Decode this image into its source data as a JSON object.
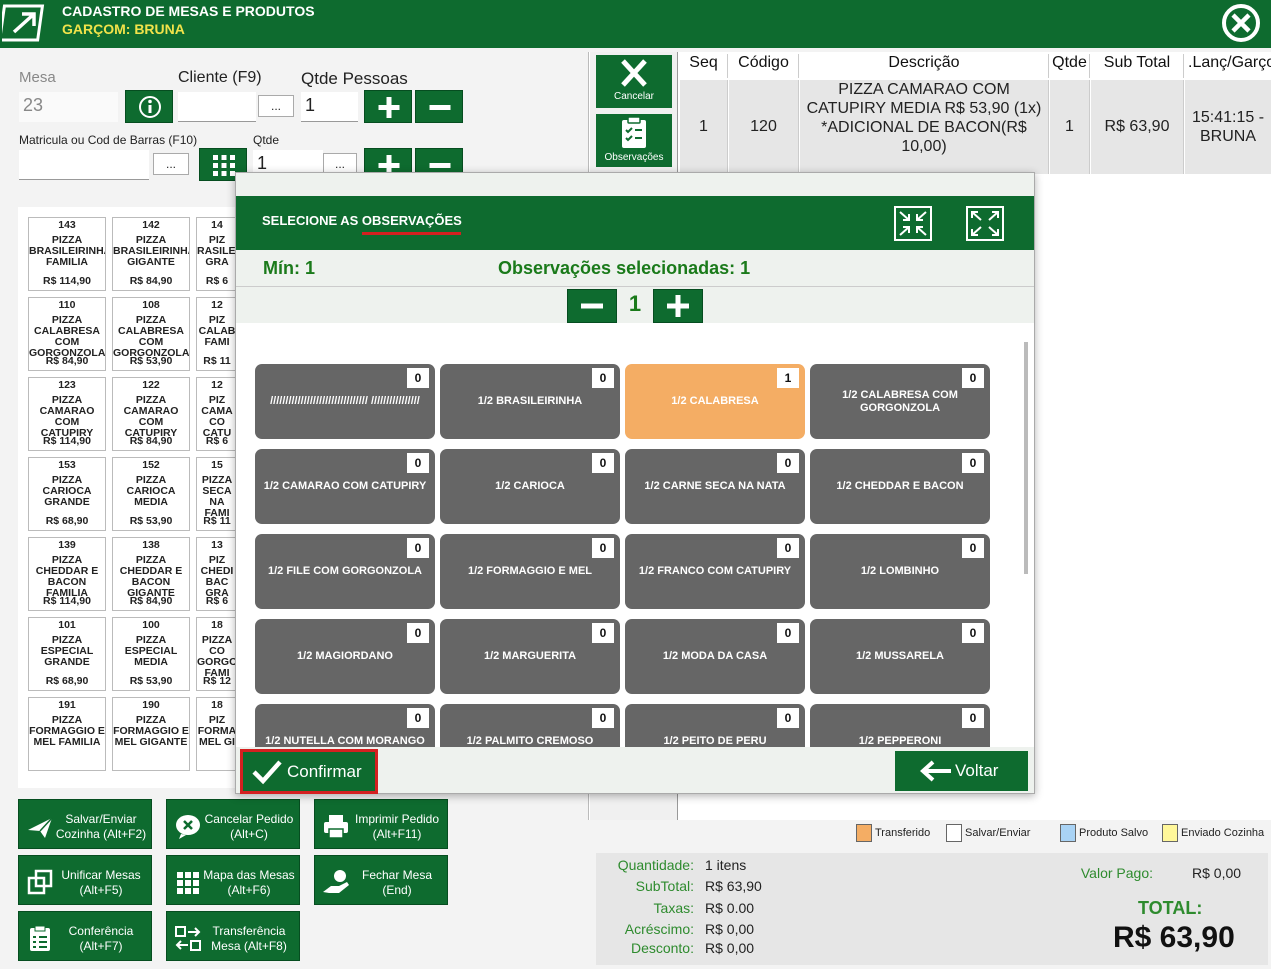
{
  "header": {
    "title": "CADASTRO DE MESAS E PRODUTOS",
    "subtitle": "GARÇOM: BRUNA"
  },
  "form": {
    "mesa_label": "Mesa",
    "mesa_value": "23",
    "cliente_label": "Cliente (F9)",
    "cliente_value": "",
    "qtde_pessoas_label": "Qtde Pessoas",
    "qtde_pessoas_value": "1",
    "matricula_label": "Matricula ou Cod de Barras (F10)",
    "matricula_value": "",
    "qtde_label": "Qtde",
    "qtde_value": "1",
    "dots": "..."
  },
  "products": [
    {
      "code": "143",
      "name": "PIZZA BRASILEIRINHA FAMILIA",
      "price": "R$ 114,90"
    },
    {
      "code": "142",
      "name": "PIZZA BRASILEIRINHA GIGANTE",
      "price": "R$ 84,90"
    },
    {
      "code": "14",
      "name": "PIZ RASILEI GRA",
      "price": "R$ 6"
    },
    {
      "code": "110",
      "name": "PIZZA CALABRESA COM GORGONZOLA",
      "price": "R$ 84,90"
    },
    {
      "code": "108",
      "name": "PIZZA CALABRESA COM GORGONZOLA",
      "price": "R$ 53,90"
    },
    {
      "code": "12",
      "name": "PIZ CALAB FAMI",
      "price": "R$ 11"
    },
    {
      "code": "123",
      "name": "PIZZA CAMARAO COM CATUPIRY",
      "price": "R$ 114,90"
    },
    {
      "code": "122",
      "name": "PIZZA CAMARAO COM CATUPIRY",
      "price": "R$ 84,90"
    },
    {
      "code": "12",
      "name": "PIZ CAMA CO CATU",
      "price": "R$ 6"
    },
    {
      "code": "153",
      "name": "PIZZA CARIOCA GRANDE",
      "price": "R$ 68,90"
    },
    {
      "code": "152",
      "name": "PIZZA CARIOCA MEDIA",
      "price": "R$ 53,90"
    },
    {
      "code": "15",
      "name": "PIZZA SECA NA FAMI",
      "price": "R$ 11"
    },
    {
      "code": "139",
      "name": "PIZZA CHEDDAR E BACON FAMILIA",
      "price": "R$ 114,90"
    },
    {
      "code": "138",
      "name": "PIZZA CHEDDAR E BACON GIGANTE",
      "price": "R$ 84,90"
    },
    {
      "code": "13",
      "name": "PIZ CHEDI BAC GRA",
      "price": "R$ 6"
    },
    {
      "code": "101",
      "name": "PIZZA ESPECIAL GRANDE",
      "price": "R$ 68,90"
    },
    {
      "code": "100",
      "name": "PIZZA ESPECIAL MEDIA",
      "price": "R$ 53,90"
    },
    {
      "code": "18",
      "name": "PIZZA CO GORGO FAMI",
      "price": "R$ 12"
    },
    {
      "code": "191",
      "name": "PIZZA FORMAGGIO E MEL FAMILIA",
      "price": ""
    },
    {
      "code": "190",
      "name": "PIZZA FORMAGGIO E MEL GIGANTE",
      "price": ""
    },
    {
      "code": "18",
      "name": "PIZ FORMA MEL GI",
      "price": ""
    }
  ],
  "actions": [
    {
      "label": "Salvar/Enviar Cozinha (Alt+F2)",
      "icon": "send-icon"
    },
    {
      "label": "Cancelar Pedido (Alt+C)",
      "icon": "cancel-chat-icon"
    },
    {
      "label": "Imprimir Pedido (Alt+F11)",
      "icon": "printer-icon"
    },
    {
      "label": "Unificar Mesas (Alt+F5)",
      "icon": "unify-icon"
    },
    {
      "label": "Mapa das Mesas (Alt+F6)",
      "icon": "grid-icon"
    },
    {
      "label": "Fechar Mesa (End)",
      "icon": "money-hand-icon"
    },
    {
      "label": "Conferência (Alt+F7)",
      "icon": "checklist-icon"
    },
    {
      "label": "Transferência Mesa (Alt+F8)",
      "icon": "transfer-icon"
    }
  ],
  "side_buttons": {
    "cancelar": "Cancelar",
    "observacoes": "Observações"
  },
  "table": {
    "headers": [
      "Seq",
      "Código",
      "Descrição",
      "Qtde",
      "Sub Total",
      ".Lanç/Garço"
    ],
    "row": {
      "seq": "1",
      "codigo": "120",
      "descricao": "PIZZA CAMARAO COM CATUPIRY MEDIA R$ 53,90 (1x) *ADICIONAL DE BACON(R$ 10,00)",
      "qtde": "1",
      "subtotal": "R$ 63,90",
      "lanc": "15:41:15 - BRUNA"
    }
  },
  "legend": [
    {
      "label": "Transferido",
      "color": "#f4ad64"
    },
    {
      "label": "Salvar/Enviar",
      "color": "#ffffff"
    },
    {
      "label": "Produto Salvo",
      "color": "#a9d3f5"
    },
    {
      "label": "Enviado Cozinha",
      "color": "#fff79a"
    }
  ],
  "totals": {
    "quantidade_label": "Quantidade:",
    "quantidade": "1 itens",
    "subtotal_label": "SubTotal:",
    "subtotal": "R$ 63,90",
    "taxas_label": "Taxas:",
    "taxas": "R$ 0.00",
    "acrescimo_label": "Acréscimo:",
    "acrescimo": "R$ 0,00",
    "desconto_label": "Desconto:",
    "desconto": "R$ 0,00",
    "valor_pago_label": "Valor Pago:",
    "valor_pago": "R$ 0,00",
    "total_label": "TOTAL:",
    "total": "R$ 63,90"
  },
  "modal": {
    "title": "SELECIONE AS OBSERVAÇÕES",
    "min_label": "Mín: 1",
    "selected_label": "Observações selecionadas: 1",
    "stepper_value": "1",
    "options": [
      {
        "label": "//////////////////////////////// ////////////////",
        "count": "0",
        "selected": false
      },
      {
        "label": "1/2 BRASILEIRINHA",
        "count": "0",
        "selected": false
      },
      {
        "label": "1/2 CALABRESA",
        "count": "1",
        "selected": true
      },
      {
        "label": "1/2 CALABRESA COM GORGONZOLA",
        "count": "0",
        "selected": false
      },
      {
        "label": "1/2 CAMARAO COM CATUPIRY",
        "count": "0",
        "selected": false
      },
      {
        "label": "1/2 CARIOCA",
        "count": "0",
        "selected": false
      },
      {
        "label": "1/2 CARNE SECA NA NATA",
        "count": "0",
        "selected": false
      },
      {
        "label": "1/2 CHEDDAR E BACON",
        "count": "0",
        "selected": false
      },
      {
        "label": "1/2 FILE COM GORGONZOLA",
        "count": "0",
        "selected": false
      },
      {
        "label": "1/2 FORMAGGIO E MEL",
        "count": "0",
        "selected": false
      },
      {
        "label": "1/2 FRANCO COM CATUPIRY",
        "count": "0",
        "selected": false
      },
      {
        "label": "1/2 LOMBINHO",
        "count": "0",
        "selected": false
      },
      {
        "label": "1/2 MAGIORDANO",
        "count": "0",
        "selected": false
      },
      {
        "label": "1/2 MARGUERITA",
        "count": "0",
        "selected": false
      },
      {
        "label": "1/2 MODA DA CASA",
        "count": "0",
        "selected": false
      },
      {
        "label": "1/2 MUSSARELA",
        "count": "0",
        "selected": false
      },
      {
        "label": "1/2 NUTELLA COM MORANGO",
        "count": "0",
        "selected": false
      },
      {
        "label": "1/2 PALMITO CREMOSO",
        "count": "0",
        "selected": false
      },
      {
        "label": "1/2 PEITO DE PERU",
        "count": "0",
        "selected": false
      },
      {
        "label": "1/2 PEPPERONI",
        "count": "0",
        "selected": false
      }
    ],
    "confirm_label": "Confirmar",
    "back_label": "Voltar"
  },
  "colors": {
    "brand_green": "#0e6b2f",
    "subtitle_yellow": "#f1e34a",
    "selected_option": "#f4ad64",
    "option_gray": "#666666",
    "highlight_red": "#d42020"
  }
}
